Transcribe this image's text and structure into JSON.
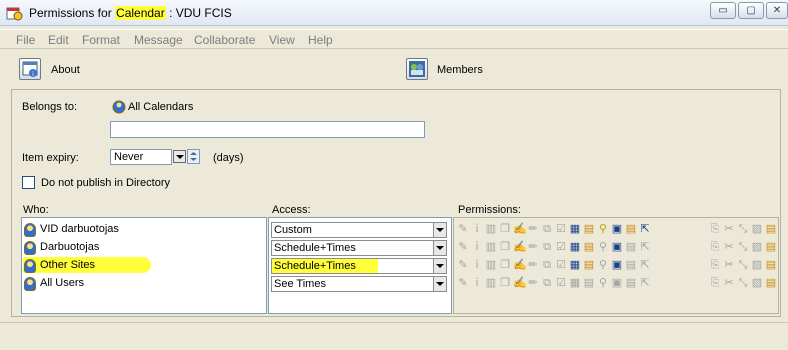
{
  "window": {
    "title_prefix": "Permissions for ",
    "title_highlight": "Calendar",
    "title_suffix": " : VDU FCIS",
    "minimize": "▭",
    "maximize": "▢",
    "close": "✕"
  },
  "menu": [
    "File",
    "Edit",
    "Format",
    "Message",
    "Collaborate",
    "View",
    "Help"
  ],
  "toolbar": {
    "about_label": "About",
    "members_label": "Members"
  },
  "form": {
    "belongs_to_label": "Belongs to:",
    "belongs_to_value": "All Calendars",
    "belongs_to_input": "",
    "item_expiry_label": "Item expiry:",
    "item_expiry_value": "Never",
    "item_expiry_unit": "(days)",
    "do_not_publish_label": "Do not publish in Directory",
    "do_not_publish_checked": false
  },
  "grid": {
    "who_header": "Who:",
    "access_header": "Access:",
    "permissions_header": "Permissions:",
    "rows": [
      {
        "who": "VID darbuotojas",
        "access": "Custom"
      },
      {
        "who": "Darbuotojas",
        "access": "Schedule+Times"
      },
      {
        "who": "Other Sites",
        "access": "Schedule+Times",
        "highlighted": true
      },
      {
        "who": "All Users",
        "access": "See Times"
      }
    ]
  },
  "colors": {
    "highlight": "#ffff3b",
    "background": "#ece9d8"
  }
}
